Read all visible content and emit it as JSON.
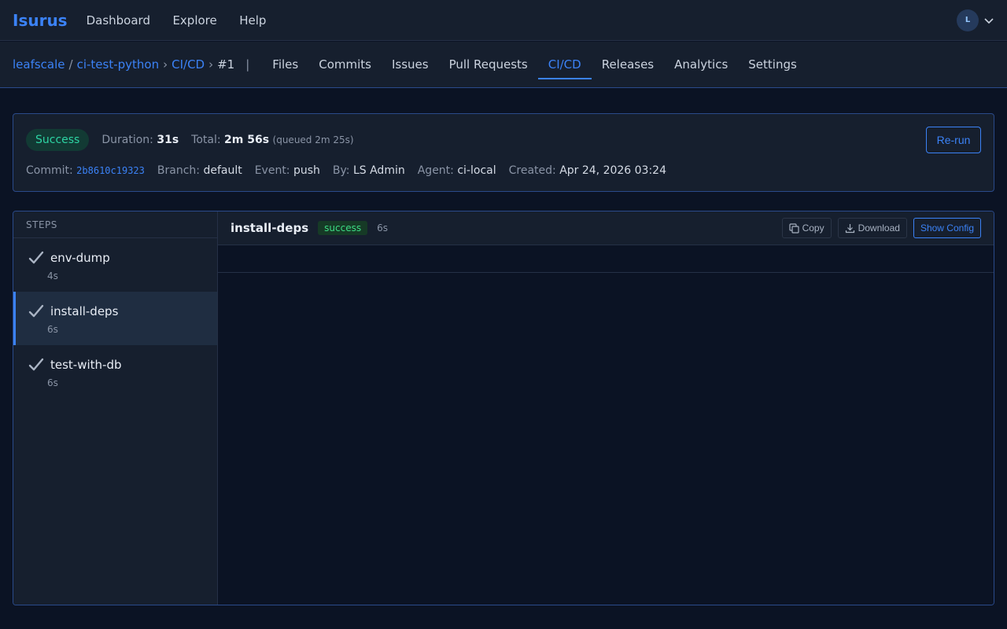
{
  "app": {
    "brand": "Isurus"
  },
  "topnav": [
    {
      "label": "Dashboard"
    },
    {
      "label": "Explore"
    },
    {
      "label": "Help"
    }
  ],
  "user": {
    "initial": "L"
  },
  "breadcrumb": {
    "owner": "leafscale",
    "slash": "/",
    "repo": "ci-test-python",
    "section": "CI/CD",
    "run": "#1",
    "chev": "›",
    "divider": "|"
  },
  "tabs": [
    {
      "label": "Files"
    },
    {
      "label": "Commits"
    },
    {
      "label": "Issues"
    },
    {
      "label": "Pull Requests"
    },
    {
      "label": "CI/CD",
      "active": true
    },
    {
      "label": "Releases"
    },
    {
      "label": "Analytics"
    },
    {
      "label": "Settings"
    }
  ],
  "run": {
    "status": "Success",
    "duration_label": "Duration:",
    "duration": "31s",
    "total_label": "Total:",
    "total": "2m 56s",
    "queued": "(queued 2m 25s)",
    "rerun_label": "Re-run",
    "commit_label": "Commit:",
    "commit": "2b8610c19323",
    "branch_label": "Branch:",
    "branch": "default",
    "event_label": "Event:",
    "event": "push",
    "by_label": "By:",
    "by": "LS Admin",
    "agent_label": "Agent:",
    "agent": "ci-local",
    "created_label": "Created:",
    "created": "Apr 24, 2026 03:24"
  },
  "steps": {
    "header": "STEPS",
    "items": [
      {
        "name": "env-dump",
        "duration": "4s"
      },
      {
        "name": "install-deps",
        "duration": "6s",
        "active": true
      },
      {
        "name": "test-with-db",
        "duration": "6s"
      }
    ]
  },
  "log": {
    "title": "install-deps",
    "status": "success",
    "duration": "6s",
    "copy_label": "Copy",
    "download_label": "Download",
    "show_config_label": "Show Config"
  },
  "colors": {
    "accent": "#3b82f6",
    "success_badge": "#2dd4a3",
    "success_pill": "#3ddc84",
    "background": "#0b1324"
  }
}
